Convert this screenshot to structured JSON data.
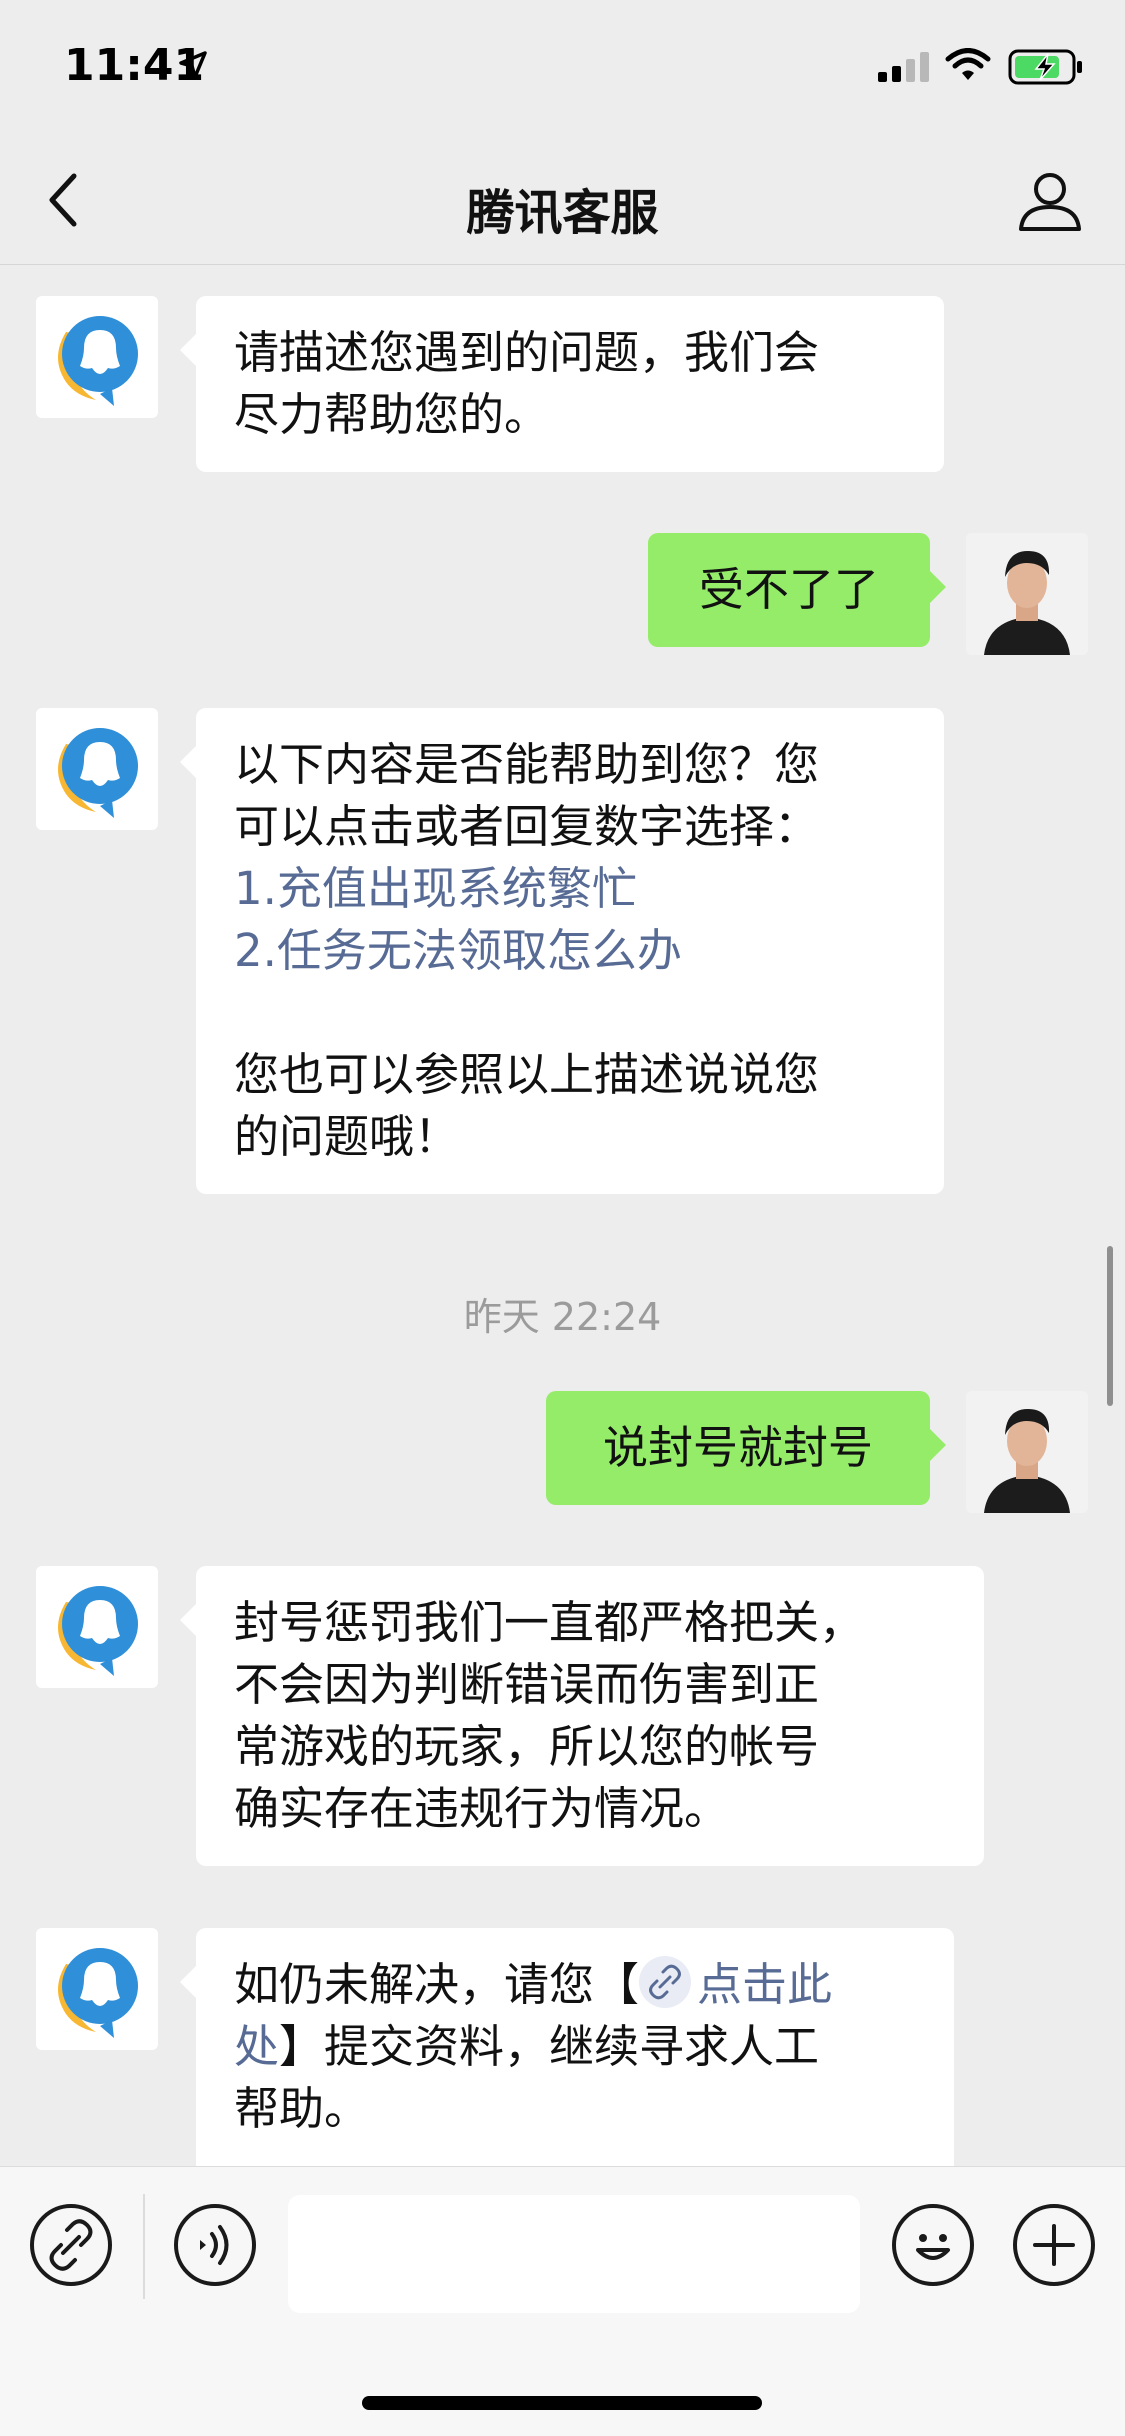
{
  "status_bar": {
    "time": "11:41"
  },
  "nav": {
    "title": "腾讯客服"
  },
  "messages": [
    {
      "side": "left",
      "lines": [
        "请描述您遇到的问题，我们会",
        "尽力帮助您的。"
      ]
    },
    {
      "side": "right",
      "lines": [
        "受不了了"
      ]
    },
    {
      "side": "left",
      "lines": [
        "以下内容是否能帮助到您？您",
        "可以点击或者回复数字选择："
      ],
      "options": [
        "1.充值出现系统繁忙",
        "2.任务无法领取怎么办"
      ],
      "footer": [
        "您也可以参照以上描述说说您",
        "的问题哦！"
      ]
    },
    {
      "side": "right",
      "lines": [
        "说封号就封号"
      ]
    },
    {
      "side": "left",
      "lines": [
        "封号惩罚我们一直都严格把关，",
        "不会因为判断错误而伤害到正",
        "常游戏的玩家，所以您的帐号",
        "确实存在违规行为情况。"
      ]
    },
    {
      "side": "left",
      "line1_prefix": "如仍未解决，请您【",
      "link_part1": "点击此",
      "link_part2": "处",
      "line2_suffix": "】提交资料，继续寻求人工",
      "line3": "帮助。"
    }
  ],
  "timestamp": "昨天 22:24",
  "colors": {
    "background": "#ededed",
    "bubble_self": "#95ec69",
    "bubble_other": "#ffffff",
    "link": "#576b95"
  },
  "icons": {
    "back": "chevron-left-icon",
    "profile": "person-icon",
    "link": "link-icon",
    "voice": "voice-icon",
    "emoji": "smiley-icon",
    "plus": "plus-icon"
  }
}
